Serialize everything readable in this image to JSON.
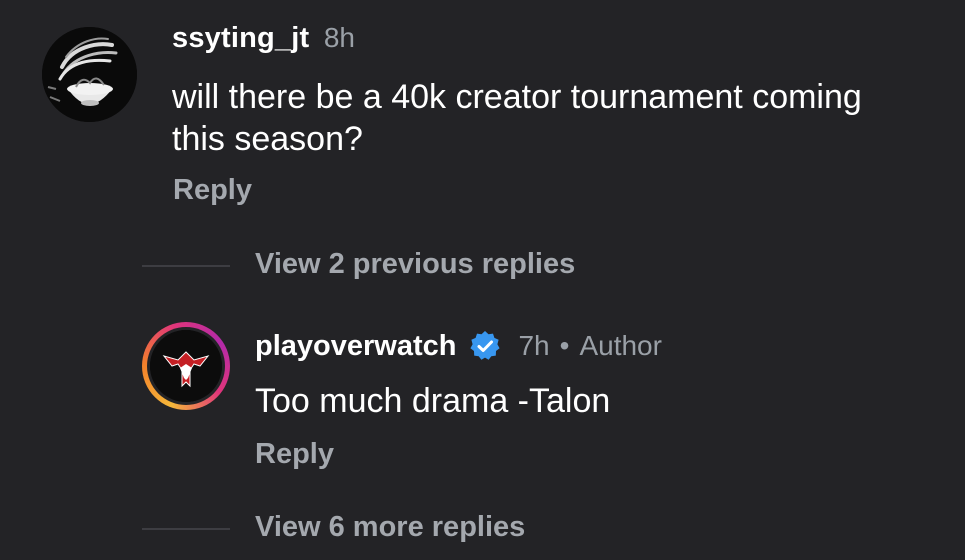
{
  "comment": {
    "avatar_icon": "skull-noodles-avatar",
    "username": "ssyting_jt",
    "timestamp": "8h",
    "text": "will there be a 40k creator tournament coming this season?",
    "reply_label": "Reply"
  },
  "view_previous": {
    "label": "View 2 previous replies"
  },
  "reply": {
    "avatar_icon": "talon-logo-avatar",
    "username": "playoverwatch",
    "verified_icon": "verified-badge-icon",
    "timestamp": "7h",
    "separator": "•",
    "role": "Author",
    "text": "Too much drama -Talon",
    "reply_label": "Reply"
  },
  "view_more": {
    "label": "View 6 more replies"
  },
  "colors": {
    "background": "#232326",
    "primary_text": "#ffffff",
    "secondary_text": "#9aa0a7",
    "link_text": "#a4a8ae",
    "verified_blue": "#3897f0",
    "avatar_ring": [
      "#f5b73a",
      "#e0357b",
      "#b32aa9"
    ]
  }
}
